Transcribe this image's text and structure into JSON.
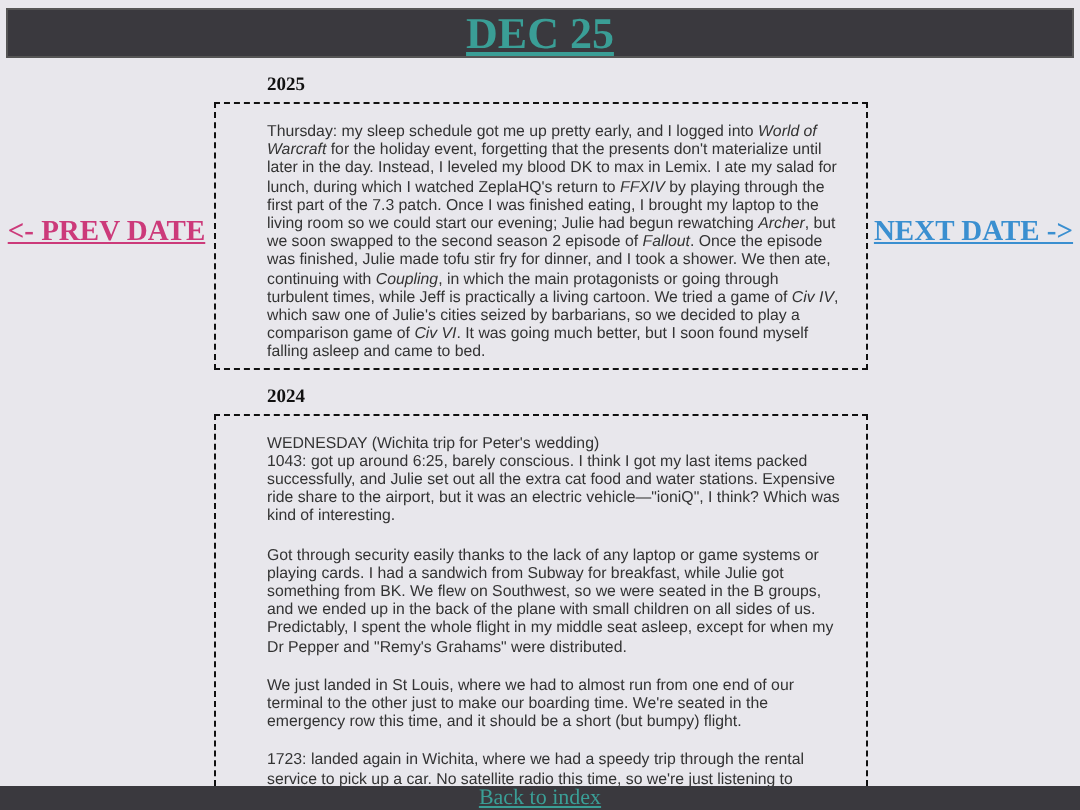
{
  "header": {
    "title": "DEC 25"
  },
  "nav": {
    "prev": "<- PREV DATE",
    "next": "NEXT DATE ->"
  },
  "entries": [
    {
      "year": "2025",
      "paragraphs": [
        "Thursday: my sleep schedule got me up pretty early, and I logged into *World of Warcraft* for the holiday event, forgetting that the presents don't materialize until later in the day. Instead, I leveled my blood DK to max in Lemix. I ate my salad for lunch, during which I watched ZeplaHQ's return to *FFXIV* by playing through the first part of the 7.3 patch. Once I was finished eating, I brought my laptop to the living room so we could start our evening; Julie had begun rewatching *Archer*, but we soon swapped to the second season 2 episode of *Fallout*. Once the episode was finished, Julie made tofu stir fry for dinner, and I took a shower. We then ate, continuing with *Coupling*, in which the main protagonists or going through turbulent times, while Jeff is practically a living cartoon. We tried a game of *Civ IV*, which saw one of Julie's cities seized by barbarians, so we decided to play a comparison game of *Civ VI*. It was going much better, but I soon found myself falling asleep and came to bed."
      ]
    },
    {
      "year": "2024",
      "paragraphs": [
        "WEDNESDAY (Wichita trip for Peter's wedding)\n1043: got up around 6:25, barely conscious. I think I got my last items packed successfully, and Julie set out all the extra cat food and water stations. Expensive ride share to the airport, but it was an electric vehicle—\"ioniQ\", I think? Which was kind of interesting.",
        "Got through security easily thanks to the lack of any laptop or game systems or playing cards. I had a sandwich from Subway for breakfast, while Julie got something from BK. We flew on Southwest, so we were seated in the B groups, and we ended up in the back of the plane with small children on all sides of us. Predictably, I spent the whole flight in my middle seat asleep, except for when my Dr Pepper and \"Remy's Grahams\" were distributed.",
        "We just landed in St Louis, where we had to almost run from one end of our terminal to the other just to make our boarding time. We're seated in the emergency row this time, and it should be a short (but bumpy) flight.",
        "1723: landed again in Wichita, where we had a speedy trip through the rental service to pick up a car. No satellite radio this time, so we're just listening to"
      ]
    }
  ],
  "footer": {
    "link": "Back to index"
  }
}
